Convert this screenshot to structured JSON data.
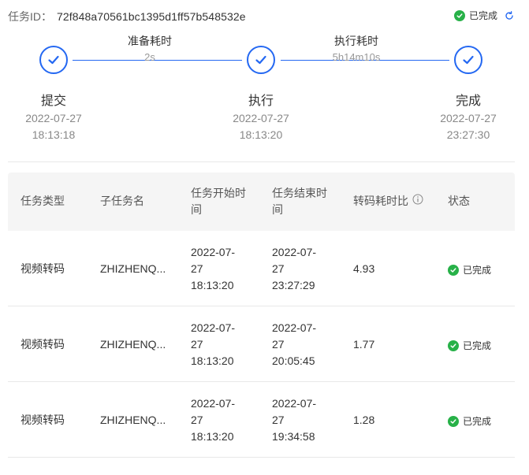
{
  "header": {
    "task_id_label": "任务ID：",
    "task_id_value": "72f848a70561bc1395d1ff57b548532e",
    "status_text": "已完成"
  },
  "steps": [
    {
      "name": "提交",
      "date": "2022-07-27",
      "time": "18:13:18"
    },
    {
      "name": "执行",
      "date": "2022-07-27",
      "time": "18:13:20"
    },
    {
      "name": "完成",
      "date": "2022-07-27",
      "time": "23:27:30"
    }
  ],
  "durations": [
    {
      "label": "准备耗时",
      "value": "2s"
    },
    {
      "label": "执行耗时",
      "value": "5h14m10s"
    }
  ],
  "table": {
    "columns": {
      "type": "任务类型",
      "subtask": "子任务名",
      "start": [
        "任务开始时",
        "间"
      ],
      "end": [
        "任务结束时",
        "间"
      ],
      "ratio": "转码耗时比",
      "status": "状态"
    },
    "rows": [
      {
        "type": "视频转码",
        "subtask": "ZHIZHENQ...",
        "start": [
          "2022-07-",
          "27",
          "18:13:20"
        ],
        "end": [
          "2022-07-",
          "27",
          "23:27:29"
        ],
        "ratio": "4.93",
        "status": "已完成"
      },
      {
        "type": "视频转码",
        "subtask": "ZHIZHENQ...",
        "start": [
          "2022-07-",
          "27",
          "18:13:20"
        ],
        "end": [
          "2022-07-",
          "27",
          "20:05:45"
        ],
        "ratio": "1.77",
        "status": "已完成"
      },
      {
        "type": "视频转码",
        "subtask": "ZHIZHENQ...",
        "start": [
          "2022-07-",
          "27",
          "18:13:20"
        ],
        "end": [
          "2022-07-",
          "27",
          "19:34:58"
        ],
        "ratio": "1.28",
        "status": "已完成"
      }
    ]
  },
  "colors": {
    "accent": "#2468f2",
    "success": "#27b148"
  },
  "icons": {
    "check": "check-icon",
    "refresh": "refresh-icon",
    "info": "info-icon"
  }
}
